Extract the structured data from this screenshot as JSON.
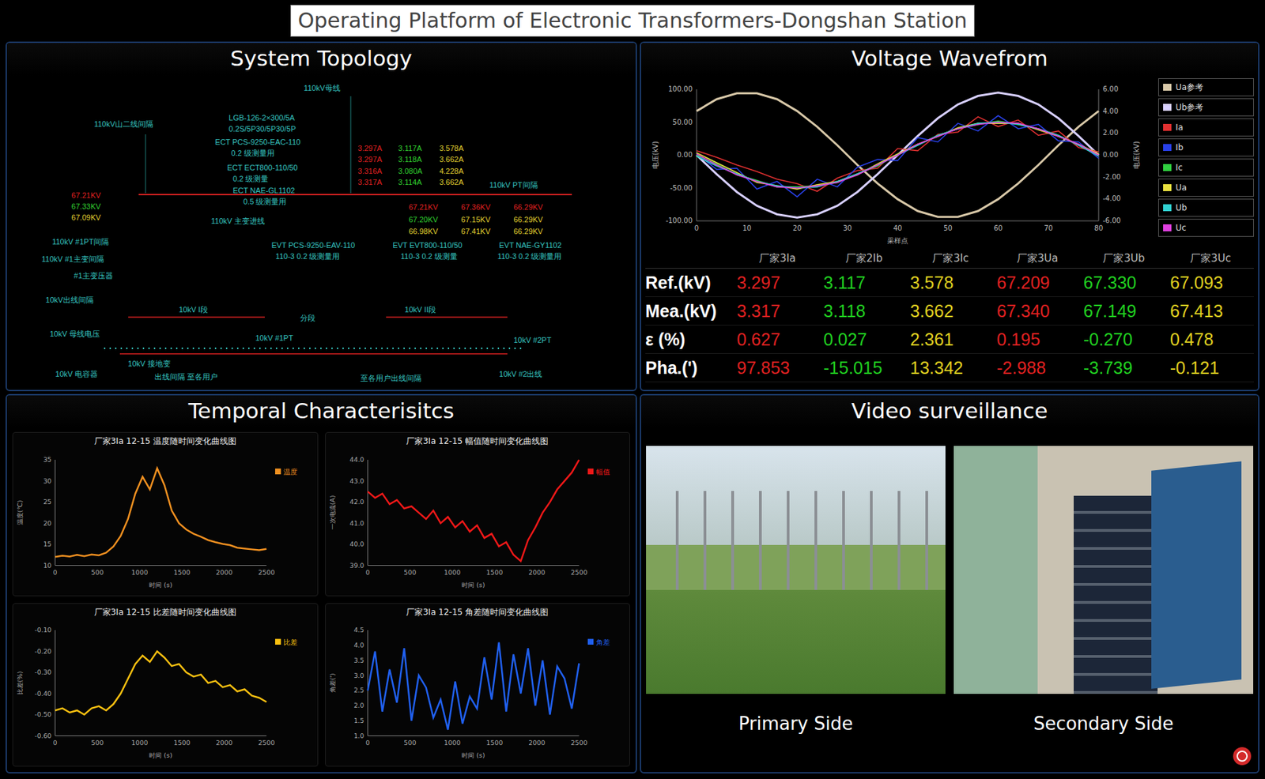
{
  "window": {
    "title": "Operating Platform of Electronic Transformers-Dongshan Station"
  },
  "topology": {
    "title": "System Topology",
    "labels": [
      {
        "text": "110kV母线",
        "color": "#36c6c0"
      },
      {
        "text": "110kV山二线间隔",
        "color": "#36c6c0"
      },
      {
        "text": "LGB-126-2×300/5A",
        "color": "#36c6c0"
      },
      {
        "text": "0.2S/5P30/5P30/5P",
        "color": "#36c6c0"
      },
      {
        "text": "ECT PCS-9250-EAC-110",
        "color": "#36c6c0"
      },
      {
        "text": "0.2 级测量用",
        "color": "#36c6c0"
      },
      {
        "text": "ECT ECT800-110/50",
        "color": "#36c6c0"
      },
      {
        "text": "0.2 级测量",
        "color": "#36c6c0"
      },
      {
        "text": "ECT NAE-GL1102",
        "color": "#36c6c0"
      },
      {
        "text": "0.5 级测量用",
        "color": "#36c6c0"
      },
      {
        "text": "3.297A",
        "color": "#e02020"
      },
      {
        "text": "3.117A",
        "color": "#30d030"
      },
      {
        "text": "3.578A",
        "color": "#e0d030"
      },
      {
        "text": "3.297A",
        "color": "#e02020"
      },
      {
        "text": "3.118A",
        "color": "#30d030"
      },
      {
        "text": "3.662A",
        "color": "#e0d030"
      },
      {
        "text": "3.316A",
        "color": "#e02020"
      },
      {
        "text": "3.080A",
        "color": "#30d030"
      },
      {
        "text": "4.228A",
        "color": "#e0d030"
      },
      {
        "text": "3.317A",
        "color": "#e02020"
      },
      {
        "text": "3.114A",
        "color": "#30d030"
      },
      {
        "text": "3.662A",
        "color": "#e0d030"
      },
      {
        "text": "110kV PT间隔",
        "color": "#36c6c0"
      },
      {
        "text": "67.21KV",
        "color": "#e02020"
      },
      {
        "text": "67.33KV",
        "color": "#30d030"
      },
      {
        "text": "67.09KV",
        "color": "#e0d030"
      },
      {
        "text": "67.21KV",
        "color": "#e02020"
      },
      {
        "text": "67.36KV",
        "color": "#e02020"
      },
      {
        "text": "66.29KV",
        "color": "#e02020"
      },
      {
        "text": "67.20KV",
        "color": "#30d030"
      },
      {
        "text": "67.15KV",
        "color": "#e0d030"
      },
      {
        "text": "66.29KV",
        "color": "#e0d030"
      },
      {
        "text": "66.98KV",
        "color": "#e0d030"
      },
      {
        "text": "67.41KV",
        "color": "#e0d030"
      },
      {
        "text": "66.29KV",
        "color": "#e0d030"
      },
      {
        "text": "110kV 主变进线",
        "color": "#36c6c0"
      },
      {
        "text": "110kV #1PT间隔",
        "color": "#36c6c0"
      },
      {
        "text": "EVT PCS-9250-EAV-110",
        "color": "#36c6c0"
      },
      {
        "text": "110-3 0.2 级测量用",
        "color": "#36c6c0"
      },
      {
        "text": "EVT EVT800-110/50",
        "color": "#36c6c0"
      },
      {
        "text": "110-3 0.2 级测量",
        "color": "#36c6c0"
      },
      {
        "text": "EVT NAE-GY1102",
        "color": "#36c6c0"
      },
      {
        "text": "110-3 0.2 级测量用",
        "color": "#36c6c0"
      },
      {
        "text": "110kV #1主变间隔",
        "color": "#36c6c0"
      },
      {
        "text": "#1主变压器",
        "color": "#36c6c0"
      },
      {
        "text": "10kV出线间隔",
        "color": "#36c6c0"
      },
      {
        "text": "10kV I段",
        "color": "#36c6c0"
      },
      {
        "text": "分段",
        "color": "#36c6c0"
      },
      {
        "text": "10kV II段",
        "color": "#36c6c0"
      },
      {
        "text": "10kV 母线电压",
        "color": "#36c6c0"
      },
      {
        "text": "10kV #1PT",
        "color": "#36c6c0"
      },
      {
        "text": "10kV #2PT",
        "color": "#36c6c0"
      },
      {
        "text": "10kV 电容器",
        "color": "#36c6c0"
      },
      {
        "text": "10kV 接地变",
        "color": "#36c6c0"
      },
      {
        "text": "出线间隔 至各用户",
        "color": "#36c6c0"
      },
      {
        "text": "至各用户出线间隔",
        "color": "#36c6c0"
      },
      {
        "text": "10kV #2出线",
        "color": "#36c6c0"
      }
    ]
  },
  "waveform": {
    "title": "Voltage Wavefrom",
    "y_axis_left": {
      "label": "电压(kV)",
      "ticks": [
        "100.00",
        "50.00",
        "0.00",
        "-50.00",
        "-100.00"
      ]
    },
    "y_axis_right": {
      "label": "电压(kV)",
      "ticks": [
        "6.00",
        "4.00",
        "2.00",
        "0.00",
        "-2.00",
        "-4.00",
        "-6.00"
      ]
    },
    "x_axis": {
      "label": "采样点",
      "ticks": [
        "0",
        "10",
        "20",
        "30",
        "40",
        "50",
        "60",
        "70",
        "80"
      ]
    },
    "series": [
      {
        "name": "Ua参考",
        "color": "#d8c8a8",
        "axis": "left",
        "values": [
          67,
          85,
          94,
          94,
          85,
          67,
          43,
          15,
          -15,
          -43,
          -67,
          -85,
          -94,
          -94,
          -85,
          -67,
          -43,
          -15,
          15,
          43,
          67
        ]
      },
      {
        "name": "Ub参考",
        "color": "#d8d0ff",
        "axis": "left",
        "values": [
          0,
          -29,
          -56,
          -77,
          -90,
          -95,
          -90,
          -77,
          -56,
          -29,
          0,
          29,
          56,
          77,
          90,
          95,
          90,
          77,
          56,
          29,
          0
        ]
      },
      {
        "name": "Ia",
        "color": "#e03030",
        "axis": "right",
        "values": [
          0.4,
          -0.2,
          -0.9,
          -1.5,
          -2.2,
          -2.6,
          -3.3,
          -2.1,
          -1.4,
          -1.2,
          0.6,
          0.4,
          1.9,
          2.1,
          3.5,
          2.6,
          3.2,
          1.8,
          2.2,
          0.7,
          0.3
        ]
      },
      {
        "name": "Ib",
        "color": "#2840e8",
        "axis": "right",
        "values": [
          0.1,
          -1.3,
          -1.2,
          -3.1,
          -2.4,
          -3.8,
          -2.2,
          -2.9,
          -1.1,
          -0.4,
          -0.5,
          1.6,
          1.2,
          2.9,
          2.2,
          3.6,
          2.4,
          2.8,
          1.3,
          1.2,
          -0.3
        ]
      },
      {
        "name": "Ic",
        "color": "#30d040",
        "axis": "right",
        "values": [
          0,
          -0.8,
          -1.8,
          -2.3,
          -2.9,
          -2.9,
          -2.8,
          -2.5,
          -1.7,
          -1,
          0.1,
          0.9,
          1.8,
          2.4,
          2.8,
          3.1,
          2.8,
          2.4,
          1.8,
          0.9,
          0
        ]
      },
      {
        "name": "Ua",
        "color": "#e8e040",
        "axis": "right",
        "values": [
          0.2,
          -0.7,
          -1.6,
          -2.5,
          -2.8,
          -3.1,
          -2.7,
          -2.4,
          -1.8,
          -0.8,
          0.1,
          1,
          1.7,
          2.5,
          2.9,
          2.9,
          2.9,
          2.3,
          1.7,
          1,
          0.1
        ]
      },
      {
        "name": "Ub",
        "color": "#30d0d0",
        "axis": "right",
        "values": [
          -0.1,
          -1,
          -1.7,
          -2.4,
          -2.8,
          -3,
          -2.9,
          -2.4,
          -1.7,
          -0.9,
          0,
          0.9,
          1.8,
          2.4,
          2.9,
          3,
          2.8,
          2.4,
          1.8,
          0.9,
          -0.1
        ]
      },
      {
        "name": "Uc",
        "color": "#e040e0",
        "axis": "right",
        "values": [
          0.1,
          -0.9,
          -1.8,
          -2.4,
          -2.9,
          -3,
          -2.8,
          -2.5,
          -1.8,
          -0.9,
          0,
          1,
          1.7,
          2.4,
          2.8,
          3,
          2.9,
          2.4,
          1.7,
          1,
          0
        ]
      }
    ]
  },
  "table": {
    "columns": [
      {
        "label": "厂家3Ia",
        "color": "#e02020"
      },
      {
        "label": "厂家2Ib",
        "color": "#20d020"
      },
      {
        "label": "厂家3Ic",
        "color": "#e0d020"
      },
      {
        "label": "厂家3Ua",
        "color": "#e02020"
      },
      {
        "label": "厂家3Ub",
        "color": "#20d020"
      },
      {
        "label": "厂家3Uc",
        "color": "#e0d020"
      }
    ],
    "rows": [
      {
        "label": "Ref.(kV)",
        "values": [
          "3.297",
          "3.117",
          "3.578",
          "67.209",
          "67.330",
          "67.093"
        ]
      },
      {
        "label": "Mea.(kV)",
        "values": [
          "3.317",
          "3.118",
          "3.662",
          "67.340",
          "67.149",
          "67.413"
        ]
      },
      {
        "label": "ε (%)",
        "values": [
          "0.627",
          "0.027",
          "2.361",
          "0.195",
          "-0.270",
          "0.478"
        ]
      },
      {
        "label": "Pha.(')",
        "values": [
          "97.853",
          "-15.015",
          "13.342",
          "-2.988",
          "-3.739",
          "-0.121"
        ]
      }
    ]
  },
  "temporal": {
    "title": "Temporal Characterisitcs",
    "charts": [
      {
        "title": "厂家3Ia 12-15 温度随时间变化曲线图",
        "legend": "温度",
        "color": "#f09020",
        "y_label": "温度(℃)",
        "x_label": "时间 (s)",
        "y_ticks": [
          "35",
          "30",
          "25",
          "20",
          "15",
          "10"
        ],
        "x_ticks": [
          "0",
          "500",
          "1000",
          "1500",
          "2000",
          "2500"
        ],
        "values": [
          12,
          12.3,
          12.1,
          12.5,
          12.2,
          12.6,
          12.4,
          13,
          14.5,
          17,
          21,
          27,
          31,
          28,
          33,
          29,
          23,
          20,
          18.5,
          17.5,
          16.8,
          16,
          15.5,
          15.1,
          14.8,
          14.2,
          14,
          13.8,
          13.6,
          13.9
        ]
      },
      {
        "title": "厂家3Ia 12-15 幅值随时间变化曲线图",
        "legend": "幅值",
        "color": "#f01818",
        "y_label": "一次电流(A)",
        "x_label": "时间 (s)",
        "y_ticks": [
          "44.0",
          "43.0",
          "42.0",
          "41.0",
          "40.0",
          "39.0"
        ],
        "x_ticks": [
          "0",
          "500",
          "1000",
          "1500",
          "2000",
          "2500"
        ],
        "values": [
          42.5,
          42.2,
          42.4,
          41.9,
          42.1,
          41.7,
          41.8,
          41.5,
          41.2,
          41.6,
          41,
          41.3,
          40.8,
          41.1,
          40.6,
          40.9,
          40.3,
          40.5,
          39.9,
          40.1,
          39.5,
          39.2,
          40.2,
          40.8,
          41.5,
          42,
          42.6,
          43,
          43.4,
          44
        ]
      },
      {
        "title": "厂家3Ia 12-15 比差随时间变化曲线图",
        "legend": "比差",
        "color": "#f8c010",
        "y_label": "比差(%)",
        "x_label": "时间 (s)",
        "y_ticks": [
          "-0.10",
          "-0.20",
          "-0.30",
          "-0.40",
          "-0.50",
          "-0.60"
        ],
        "x_ticks": [
          "0",
          "500",
          "1000",
          "1500",
          "2000",
          "2500"
        ],
        "values": [
          -0.48,
          -0.47,
          -0.49,
          -0.48,
          -0.5,
          -0.47,
          -0.46,
          -0.48,
          -0.45,
          -0.4,
          -0.33,
          -0.26,
          -0.22,
          -0.25,
          -0.2,
          -0.23,
          -0.27,
          -0.26,
          -0.3,
          -0.32,
          -0.31,
          -0.35,
          -0.34,
          -0.37,
          -0.36,
          -0.39,
          -0.38,
          -0.41,
          -0.42,
          -0.44
        ]
      },
      {
        "title": "厂家3Ia 12-15 角差随时间变化曲线图",
        "legend": "角差",
        "color": "#2060f0",
        "y_label": "角差(')",
        "x_label": "时间 (s)",
        "y_ticks": [
          "4.5",
          "4.0",
          "3.5",
          "3.0",
          "2.5",
          "2.0",
          "1.5",
          "1.0"
        ],
        "x_ticks": [
          "0",
          "500",
          "1000",
          "1500",
          "2000",
          "2500"
        ],
        "values": [
          2.5,
          3.8,
          1.8,
          3.2,
          2.1,
          3.9,
          1.5,
          3,
          2.6,
          1.6,
          2.2,
          1.2,
          2.8,
          1.4,
          2.3,
          1.9,
          3.6,
          2.2,
          4.1,
          1.8,
          3.7,
          2.4,
          3.9,
          2,
          3.5,
          1.7,
          3.3,
          2.9,
          1.9,
          3.4
        ]
      }
    ]
  },
  "video": {
    "title": "Video surveillance",
    "feeds": [
      {
        "caption": "Primary Side"
      },
      {
        "caption": "Secondary Side"
      }
    ]
  }
}
